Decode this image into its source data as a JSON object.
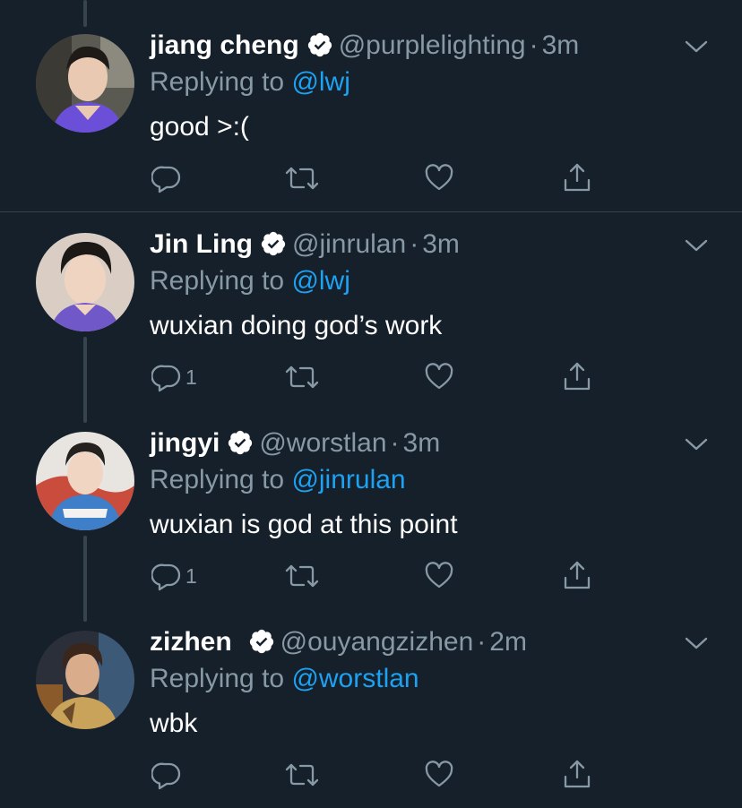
{
  "colors": {
    "background": "#15202b",
    "text": "#ffffff",
    "secondary": "#8899a6",
    "link": "#1da1f2",
    "border": "#38444d"
  },
  "icons": {
    "reply": "reply-icon",
    "retweet": "retweet-icon",
    "like": "heart-icon",
    "share": "share-icon",
    "more": "chevron-down-icon",
    "verified": "verified-badge-icon"
  },
  "tweets": [
    {
      "name": "jiang cheng",
      "handle": "@purplelighting",
      "dot": "·",
      "time": "3m",
      "replying_prefix": "Replying to",
      "replying_to": "@lwj",
      "text": "good >:(",
      "reply_count": ""
    },
    {
      "name": "Jin Ling",
      "handle": "@jinrulan",
      "dot": "·",
      "time": "3m",
      "replying_prefix": "Replying to",
      "replying_to": "@lwj",
      "text": "wuxian doing god’s work",
      "reply_count": "1"
    },
    {
      "name": "jingyi",
      "handle": "@worstlan",
      "dot": "·",
      "time": "3m",
      "replying_prefix": "Replying to",
      "replying_to": "@jinrulan",
      "text": "wuxian is god at this point",
      "reply_count": "1"
    },
    {
      "name": "zizhen",
      "handle": "@ouyangzizhen",
      "dot": "·",
      "time": "2m",
      "replying_prefix": "Replying to",
      "replying_to": "@worstlan",
      "text": "wbk",
      "reply_count": ""
    }
  ]
}
